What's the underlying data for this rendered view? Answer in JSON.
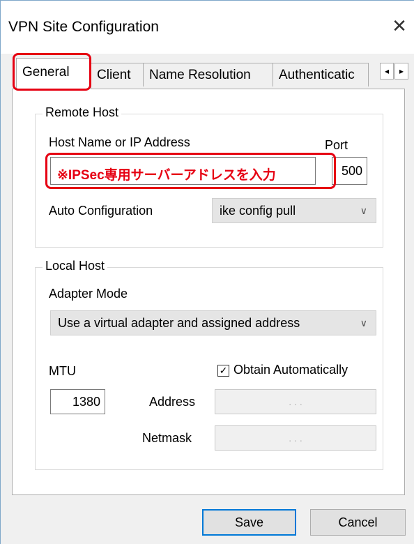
{
  "window": {
    "title": "VPN Site Configuration",
    "close_symbol": "✕"
  },
  "tabs": [
    {
      "label": "General"
    },
    {
      "label": "Client"
    },
    {
      "label": "Name Resolution"
    },
    {
      "label": "Authenticatic"
    }
  ],
  "tab_scroll": {
    "left": "◂",
    "right": "▸"
  },
  "remote_host": {
    "legend": "Remote Host",
    "host_label": "Host Name or IP Address",
    "port_label": "Port",
    "host_annotation": "※IPSec専用サーバーアドレスを入力",
    "port_value": "500",
    "auto_config_label": "Auto Configuration",
    "auto_config_value": "ike config pull"
  },
  "local_host": {
    "legend": "Local Host",
    "adapter_mode_label": "Adapter Mode",
    "adapter_mode_value": "Use a virtual adapter and assigned address",
    "mtu_label": "MTU",
    "mtu_value": "1380",
    "obtain_auto_label": "Obtain Automatically",
    "obtain_auto_checked": true,
    "address_label": "Address",
    "netmask_label": "Netmask",
    "ip_placeholder": ".   .   ."
  },
  "buttons": {
    "save": "Save",
    "cancel": "Cancel"
  },
  "colors": {
    "annotation_red": "#e60012",
    "default_button_border": "#0078d7"
  }
}
